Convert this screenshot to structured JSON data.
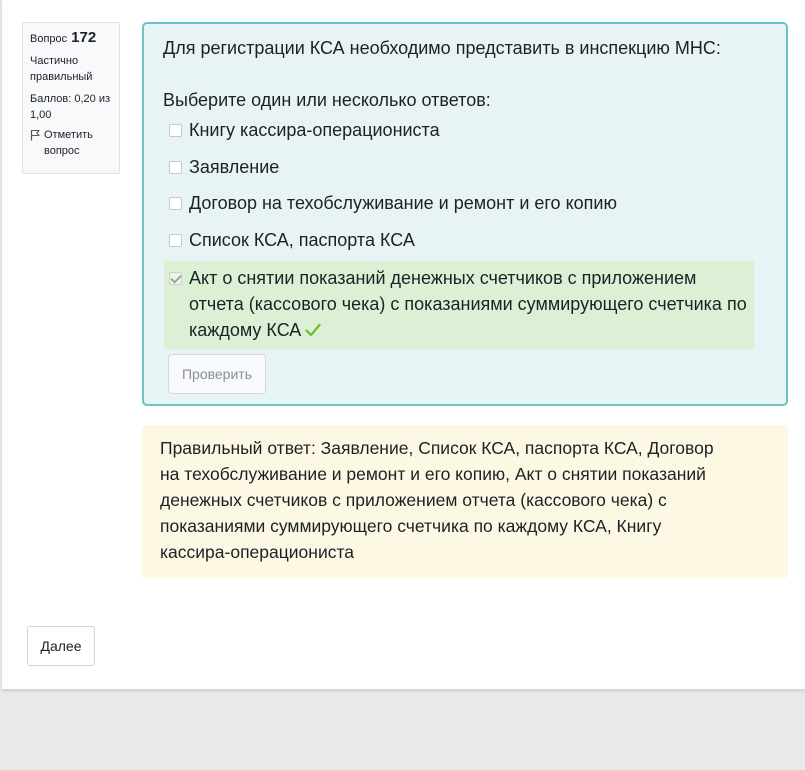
{
  "info": {
    "question_label": "Вопрос",
    "question_number": "172",
    "state": "Частично правильный",
    "grade": "Баллов: 0,20 из 1,00",
    "flag_label": "Отметить вопрос"
  },
  "question": {
    "text": "Для регистрации КСА необходимо представить в инспекцию МНС:",
    "prompt": "Выберите один или несколько ответов:",
    "answers": [
      {
        "label": "Книгу кассира-операциониста",
        "checked": false
      },
      {
        "label": "Заявление",
        "checked": false
      },
      {
        "label": "Договор на техобслуживание и ремонт и его копию",
        "checked": false
      },
      {
        "label": "Список КСА, паспорта КСА",
        "checked": false
      },
      {
        "label": "Акт о снятии показаний денежных счетчиков с приложением отчета (кассового чека) с показаниями суммирующего счетчика по каждому КСА",
        "checked": true
      }
    ],
    "check_button": "Проверить"
  },
  "feedback": {
    "text": "Правильный ответ: Заявление, Список КСА, паспорта КСА, Договор на техобслуживание и ремонт и его копию, Акт о снятии показаний денежных счетчиков с приложением отчета (кассового чека) с показаниями суммирующего счетчика по каждому КСА, Книгу кассира-операциониста"
  },
  "nav": {
    "next_button": "Далее"
  },
  "colors": {
    "question_bg": "#e7f3f5",
    "question_border": "#6cc2ca",
    "correct_bg": "#dcf0d6",
    "feedback_bg": "#fcf8e3",
    "tick": "#6cbd2a"
  }
}
